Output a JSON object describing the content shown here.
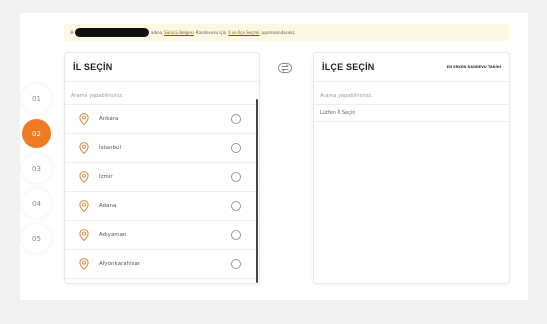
{
  "notice": {
    "text_before": "adına",
    "link1": "Sürücü Belgesi",
    "text_middle": "Randevusu için",
    "link2": "İl ve İlçe Seçimi",
    "text_after": "aşamasındasınız."
  },
  "steps": [
    "01",
    "02",
    "03",
    "04",
    "05"
  ],
  "active_step": "02",
  "province_panel": {
    "title": "İL SEÇİN",
    "search_placeholder": "Arama yapabilirsiniz.",
    "items": [
      {
        "label": "Ankara"
      },
      {
        "label": "İstanbul"
      },
      {
        "label": "İzmir"
      },
      {
        "label": "Adana"
      },
      {
        "label": "Adıyaman"
      },
      {
        "label": "Afyonkarahisar"
      }
    ]
  },
  "district_panel": {
    "title": "İLÇE SEÇİN",
    "link": "EN ERKEN RANDEVU TARİHİ",
    "search_placeholder": "Arama yapabilirsiniz.",
    "hint": "Lütfen İl Seçin"
  },
  "colors": {
    "accent": "#ef7a22",
    "notice_bg": "#fdf8e2",
    "pin": "#d98a3d"
  },
  "icons": {
    "pin": "map-pin-icon",
    "swap": "swap-icon"
  }
}
